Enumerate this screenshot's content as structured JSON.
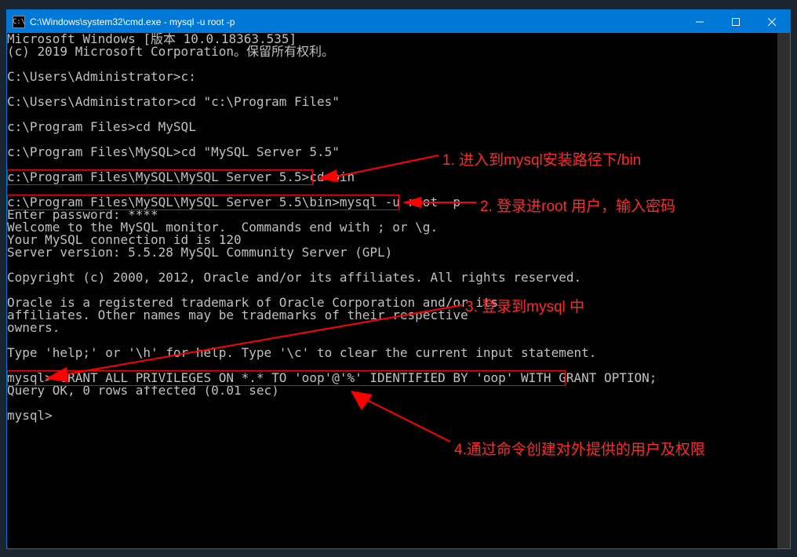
{
  "window": {
    "title": "C:\\Windows\\system32\\cmd.exe - mysql  -u root -p"
  },
  "annotations": {
    "a1": "1. 进入到mysql安装路径下/bin",
    "a2": "2. 登录进root 用户，输入密码",
    "a3": "3. 登录到mysql 中",
    "a4": "4.通过命令创建对外提供的用户及权限"
  },
  "term": {
    "lines": [
      "Microsoft Windows [版本 10.0.18363.535]",
      "(c) 2019 Microsoft Corporation。保留所有权利。",
      "",
      "C:\\Users\\Administrator>c:",
      "",
      "C:\\Users\\Administrator>cd \"c:\\Program Files\"",
      "",
      "c:\\Program Files>cd MySQL",
      "",
      "c:\\Program Files\\MySQL>cd \"MySQL Server 5.5\"",
      "",
      "c:\\Program Files\\MySQL\\MySQL Server 5.5>cd bin",
      "",
      "c:\\Program Files\\MySQL\\MySQL Server 5.5\\bin>mysql -u root -p",
      "Enter password: ****",
      "Welcome to the MySQL monitor.  Commands end with ; or \\g.",
      "Your MySQL connection id is 120",
      "Server version: 5.5.28 MySQL Community Server (GPL)",
      "",
      "Copyright (c) 2000, 2012, Oracle and/or its affiliates. All rights reserved.",
      "",
      "Oracle is a registered trademark of Oracle Corporation and/or its",
      "affiliates. Other names may be trademarks of their respective",
      "owners.",
      "",
      "Type 'help;' or '\\h' for help. Type '\\c' to clear the current input statement.",
      "",
      "mysql> GRANT ALL PRIVILEGES ON *.* TO 'oop'@'%' IDENTIFIED BY 'oop' WITH GRANT OPTION;",
      "Query OK, 0 rows affected (0.01 sec)",
      "",
      "mysql>"
    ]
  }
}
